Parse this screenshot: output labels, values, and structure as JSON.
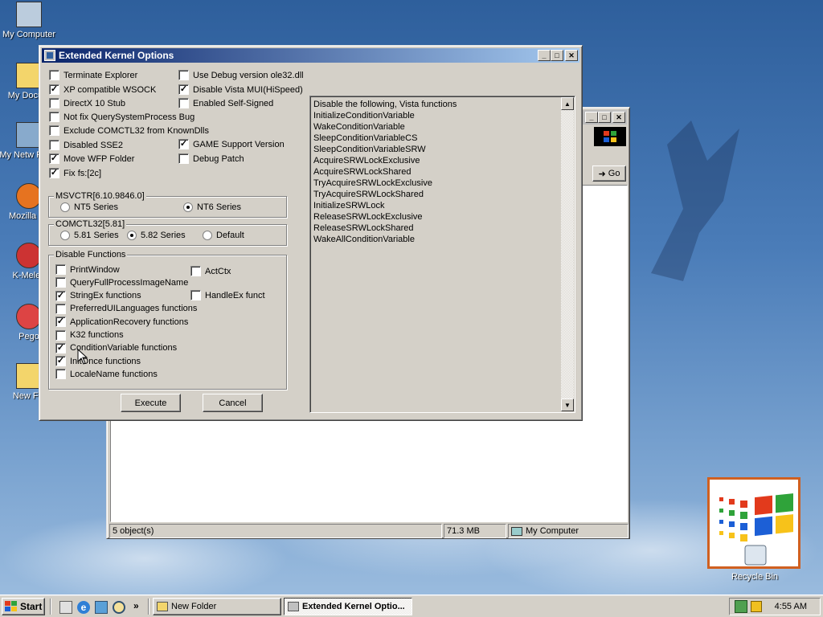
{
  "desktop": {
    "icons": [
      {
        "label": "My Computer",
        "icon": "my-computer-icon"
      },
      {
        "label": "My Docum",
        "icon": "folder-icon"
      },
      {
        "label": "My Netw Place",
        "icon": "network-icon"
      },
      {
        "label": "Mozilla Fir",
        "icon": "firefox-icon"
      },
      {
        "label": "K-Meleo",
        "icon": "k-meleon-icon"
      },
      {
        "label": "Pego",
        "icon": "pegasus-icon"
      },
      {
        "label": "New Fol",
        "icon": "folder-icon"
      }
    ],
    "recycle_bin": "Recycle Bin"
  },
  "background_window": {
    "go_label": "Go",
    "status": {
      "objects": "5 object(s)",
      "size": "71.3 MB",
      "location": "My Computer"
    }
  },
  "dialog": {
    "title": "Extended Kernel Options",
    "options_left": [
      {
        "label": "Terminate Explorer",
        "checked": false
      },
      {
        "label": "XP compatible WSOCK",
        "checked": true
      },
      {
        "label": "DirectX 10 Stub",
        "checked": false
      },
      {
        "label": "Not fix QuerySystemProcess Bug",
        "checked": false
      },
      {
        "label": "Exclude COMCTL32 from KnownDlls",
        "checked": false
      },
      {
        "label": "Disabled SSE2",
        "checked": false
      },
      {
        "label": "Move WFP Folder",
        "checked": true
      },
      {
        "label": "Fix fs:[2c]",
        "checked": true
      }
    ],
    "options_right": [
      {
        "label": "Use Debug version ole32.dll",
        "checked": false
      },
      {
        "label": "Disable Vista MUI(HiSpeed)",
        "checked": true
      },
      {
        "label": "Enabled Self-Signed",
        "checked": false
      },
      {
        "label": "GAME Support Version",
        "checked": true
      },
      {
        "label": "Debug Patch",
        "checked": false
      }
    ],
    "msvctr": {
      "legend": "MSVCTR[6.10.9846.0]",
      "options": [
        {
          "label": "NT5 Series",
          "selected": false
        },
        {
          "label": "NT6 Series",
          "selected": true
        }
      ]
    },
    "comctl": {
      "legend": "COMCTL32[5.81]",
      "options": [
        {
          "label": "5.81 Series",
          "selected": false
        },
        {
          "label": "5.82 Series",
          "selected": true
        },
        {
          "label": "Default",
          "selected": false
        }
      ]
    },
    "disable_functions": {
      "legend": "Disable Functions",
      "left": [
        {
          "label": "PrintWindow",
          "checked": false
        },
        {
          "label": "QueryFullProcessImageName",
          "checked": false
        },
        {
          "label": "StringEx functions",
          "checked": true
        },
        {
          "label": "PreferredUILanguages functions",
          "checked": false
        },
        {
          "label": "ApplicationRecovery functions",
          "checked": true
        },
        {
          "label": "K32 functions",
          "checked": false
        },
        {
          "label": "ConditionVariable functions",
          "checked": true
        },
        {
          "label": "InitOnce functions",
          "checked": true
        },
        {
          "label": "LocaleName functions",
          "checked": false
        }
      ],
      "right": [
        {
          "label": "ActCtx",
          "checked": false
        },
        {
          "label": "HandleEx funct",
          "checked": false
        }
      ]
    },
    "execute_label": "Execute",
    "cancel_label": "Cancel",
    "list_items": [
      "Disable the following, Vista functions",
      "InitializeConditionVariable",
      "WakeConditionVariable",
      "SleepConditionVariableCS",
      "SleepConditionVariableSRW",
      "AcquireSRWLockExclusive",
      "AcquireSRWLockShared",
      "TryAcquireSRWLockExclusive",
      "TryAcquireSRWLockShared",
      "InitializeSRWLock",
      "ReleaseSRWLockExclusive",
      "ReleaseSRWLockShared",
      "WakeAllConditionVariable"
    ]
  },
  "taskbar": {
    "start_label": "Start",
    "tasks": [
      {
        "label": "New Folder",
        "active": false
      },
      {
        "label": "Extended Kernel Optio...",
        "active": true
      }
    ],
    "clock": "4:55 AM"
  }
}
